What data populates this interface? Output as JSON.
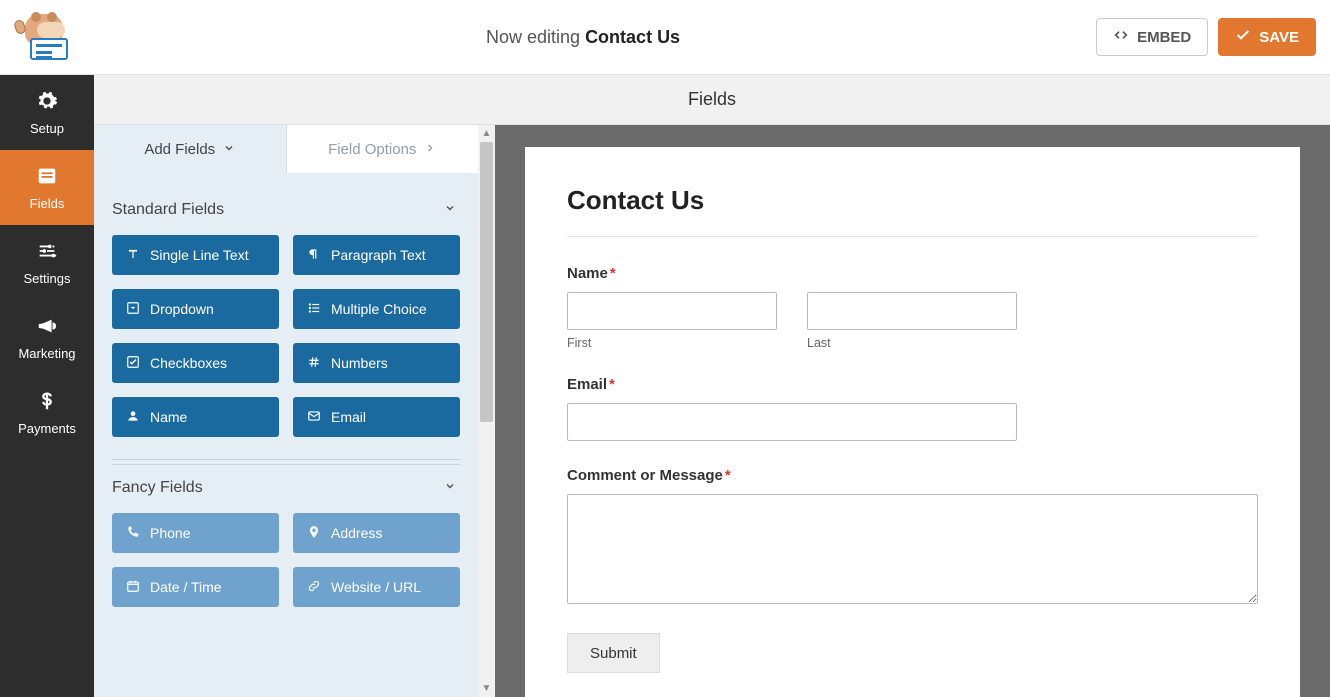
{
  "header": {
    "editing_prefix": "Now editing ",
    "form_name": "Contact Us",
    "embed_label": "EMBED",
    "save_label": "SAVE"
  },
  "nav": {
    "setup": "Setup",
    "fields": "Fields",
    "settings": "Settings",
    "marketing": "Marketing",
    "payments": "Payments"
  },
  "section_title": "Fields",
  "panel": {
    "tab_add": "Add Fields",
    "tab_options": "Field Options",
    "group_standard": "Standard Fields",
    "group_fancy": "Fancy Fields",
    "standard": {
      "single_line": "Single Line Text",
      "paragraph": "Paragraph Text",
      "dropdown": "Dropdown",
      "multiple": "Multiple Choice",
      "checkboxes": "Checkboxes",
      "numbers": "Numbers",
      "name": "Name",
      "email": "Email"
    },
    "fancy": {
      "phone": "Phone",
      "address": "Address",
      "datetime": "Date / Time",
      "website": "Website / URL"
    }
  },
  "form": {
    "title": "Contact Us",
    "name_label": "Name",
    "first": "First",
    "last": "Last",
    "email_label": "Email",
    "message_label": "Comment or Message",
    "submit": "Submit",
    "required_mark": "*"
  }
}
